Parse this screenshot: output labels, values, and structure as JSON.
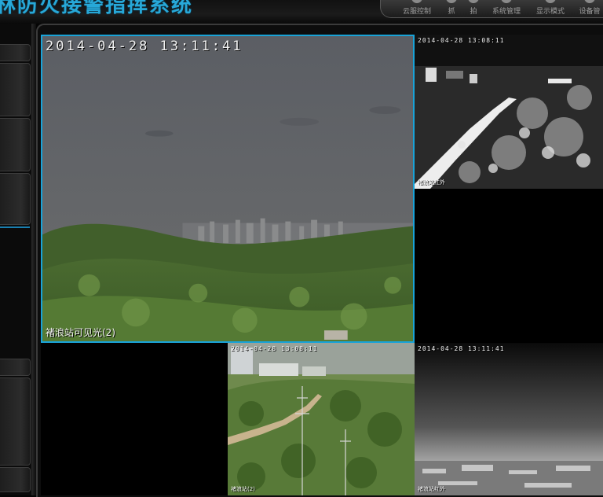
{
  "header": {
    "title": "林防火接警指挥系统",
    "toolbar": [
      {
        "id": "cloud-control",
        "label": "云服控制",
        "icon": "camera-icon"
      },
      {
        "id": "capture",
        "label": "抓",
        "icon": "capture-icon"
      },
      {
        "id": "shoot",
        "label": "拍",
        "icon": "photo-icon"
      },
      {
        "id": "system-management",
        "label": "系统管理",
        "icon": "gear-icon"
      },
      {
        "id": "display-mode",
        "label": "显示模式",
        "icon": "display-icon"
      },
      {
        "id": "device-management",
        "label": "设备管",
        "icon": "device-icon"
      }
    ]
  },
  "video": {
    "main": {
      "timestamp": "2014-04-28 13:11:41",
      "label": "褚浪站可见光(2)"
    },
    "thermal_top": {
      "timestamp": "2014-04-28 13:08:11",
      "label": "褚浪站红外"
    },
    "bottom_mid": {
      "timestamp": "2014-04-28 13:08:11",
      "label": "褚浪站(2)"
    },
    "thermal_bottom": {
      "timestamp": "2014-04-28 13:11:41",
      "label": "褚浪站红外"
    }
  },
  "colors": {
    "accent": "#19a3d8",
    "title": "#27a8d8"
  }
}
